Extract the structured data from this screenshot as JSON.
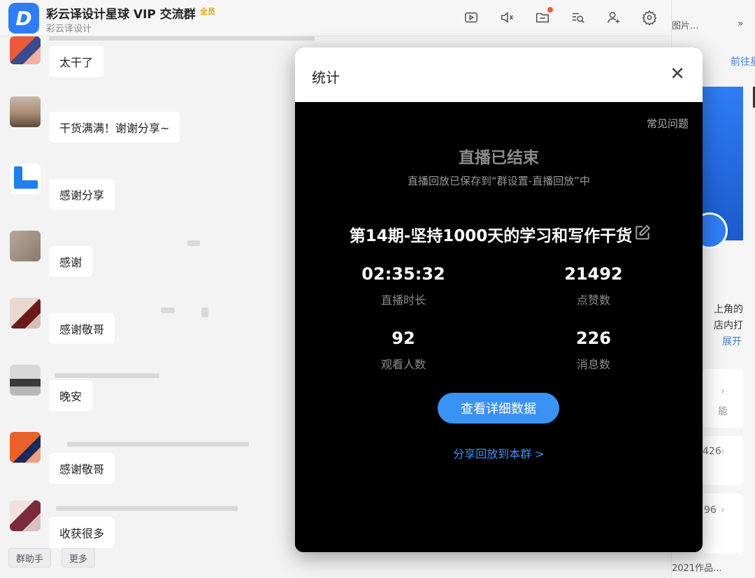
{
  "header": {
    "app_icon_letter": "D",
    "title": "彩云译设计星球 VIP 交流群",
    "badge": "全员",
    "subtitle": "彩云译设计",
    "icons": [
      "live-icon",
      "mute-icon",
      "folder-icon",
      "search-chat-icon",
      "add-member-icon",
      "settings-icon"
    ]
  },
  "messages": [
    {
      "text": "太干了"
    },
    {
      "text": "干货满满！谢谢分享~"
    },
    {
      "text": "感谢分享"
    },
    {
      "text": "感谢"
    },
    {
      "text": "感谢敬哥"
    },
    {
      "text": "晚安"
    },
    {
      "text": "感谢敬哥"
    },
    {
      "text": "收获很多"
    }
  ],
  "quick_buttons": [
    "群助手",
    "更多"
  ],
  "right_panel": {
    "top_text": "图片...",
    "goto": "前往星",
    "corner_text1": "上角的",
    "corner_text2": "店内打",
    "corner_text3": "展开",
    "func_text": "能",
    "num1": "426",
    "num2": "96",
    "bottom_text": "2021作品..."
  },
  "modal": {
    "title": "统计",
    "faq": "常见问题",
    "ended": "直播已结束",
    "saved_note": "直播回放已保存到“群设置-直播回放”中",
    "live_title": "第14期-坚持1000天的学习和写作干货",
    "stats": {
      "duration": {
        "value": "02:35:32",
        "label": "直播时长"
      },
      "likes": {
        "value": "21492",
        "label": "点赞数"
      },
      "viewers": {
        "value": "92",
        "label": "观看人数"
      },
      "messages": {
        "value": "226",
        "label": "消息数"
      }
    },
    "detail_button": "查看详细数据",
    "share_link": "分享回放到本群 >"
  },
  "colors": {
    "accent": "#3b92f5",
    "brand": "#2f7df6",
    "badge": "#e0a020",
    "notify_dot": "#ff5a2c"
  }
}
